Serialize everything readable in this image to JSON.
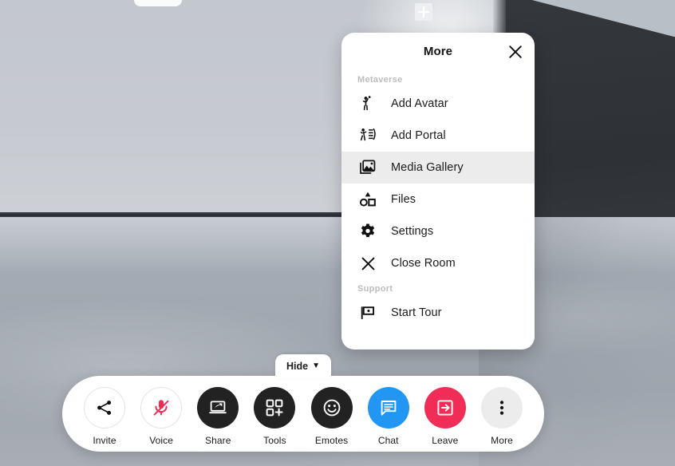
{
  "scene": {
    "name": "metaverse-room-3d-view",
    "description": "3D virtual room with light grey wall, dark angled wall and grey floor",
    "colors": {
      "wall_left": "#c6cad0",
      "wall_right": "#34383c",
      "floor": "#a3a9b2"
    }
  },
  "more_panel": {
    "title": "More",
    "close_icon": "close-icon",
    "sections": [
      {
        "label": "Metaverse",
        "items": [
          {
            "label": "Add Avatar",
            "icon": "avatar-icon",
            "active": false
          },
          {
            "label": "Add Portal",
            "icon": "portal-icon",
            "active": false
          },
          {
            "label": "Media Gallery",
            "icon": "image-gallery-icon",
            "active": true
          },
          {
            "label": "Files",
            "icon": "shapes-files-icon",
            "active": false
          },
          {
            "label": "Settings",
            "icon": "gear-icon",
            "active": false
          },
          {
            "label": "Close Room",
            "icon": "close-x-icon",
            "active": false
          }
        ]
      },
      {
        "label": "Support",
        "items": [
          {
            "label": "Start Tour",
            "icon": "flag-icon",
            "active": false
          }
        ]
      }
    ]
  },
  "hide_button": {
    "label": "Hide",
    "caret": "▼"
  },
  "toolbar": {
    "items": [
      {
        "label": "Invite",
        "icon": "share-nodes-icon",
        "style": "light"
      },
      {
        "label": "Voice",
        "icon": "mic-muted-icon",
        "style": "light"
      },
      {
        "label": "Share",
        "icon": "screen-share-icon",
        "style": "dark"
      },
      {
        "label": "Tools",
        "icon": "grid-plus-icon",
        "style": "dark"
      },
      {
        "label": "Emotes",
        "icon": "smiley-icon",
        "style": "dark"
      },
      {
        "label": "Chat",
        "icon": "chat-bubble-icon",
        "style": "blue"
      },
      {
        "label": "Leave",
        "icon": "exit-door-icon",
        "style": "pink"
      },
      {
        "label": "More",
        "icon": "dots-vertical-icon",
        "style": "grey"
      }
    ],
    "accent_colors": {
      "chat_blue": "#2196f3",
      "leave_pink": "#ef2d56",
      "voice_muted_pink": "#ef2d56",
      "dark": "#222222",
      "grey": "#ececec"
    }
  }
}
